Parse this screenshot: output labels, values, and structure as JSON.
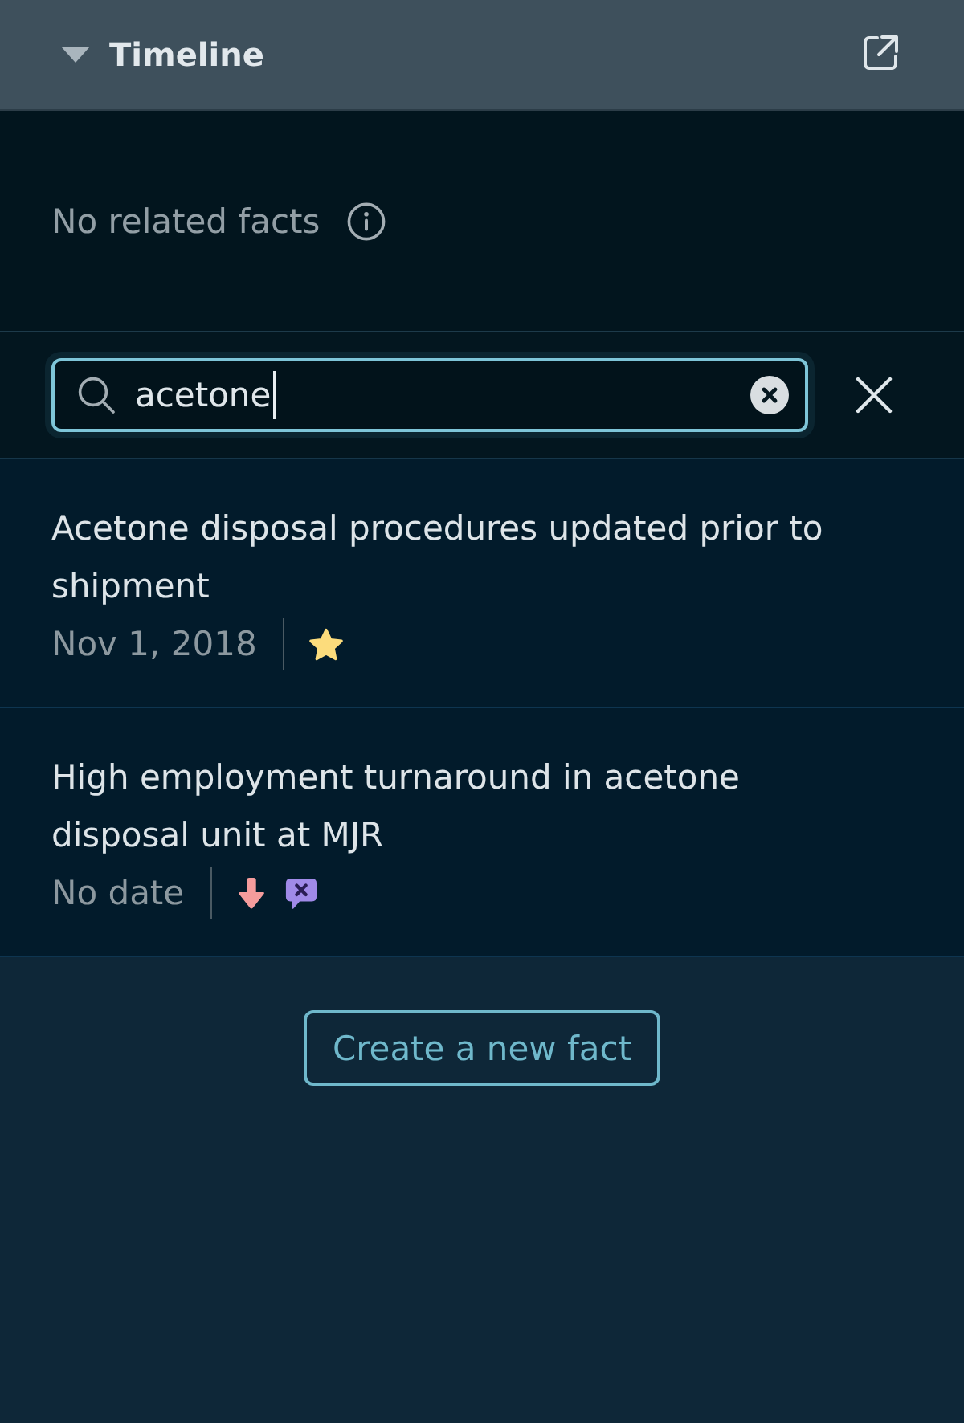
{
  "panel": {
    "title": "Timeline",
    "expanded": true
  },
  "related": {
    "message": "No related facts"
  },
  "search": {
    "value": "acetone",
    "focused": true
  },
  "facts": [
    {
      "title": "Acetone disposal procedures updated prior to shipment",
      "date": "Nov 1, 2018",
      "markers": [
        {
          "kind": "star"
        }
      ]
    },
    {
      "title": "High employment turnaround in acetone disposal unit at MJR",
      "date": "No date",
      "markers": [
        {
          "kind": "arrow-down"
        },
        {
          "kind": "bubble-x"
        }
      ]
    }
  ],
  "create_button": "Create a new fact"
}
